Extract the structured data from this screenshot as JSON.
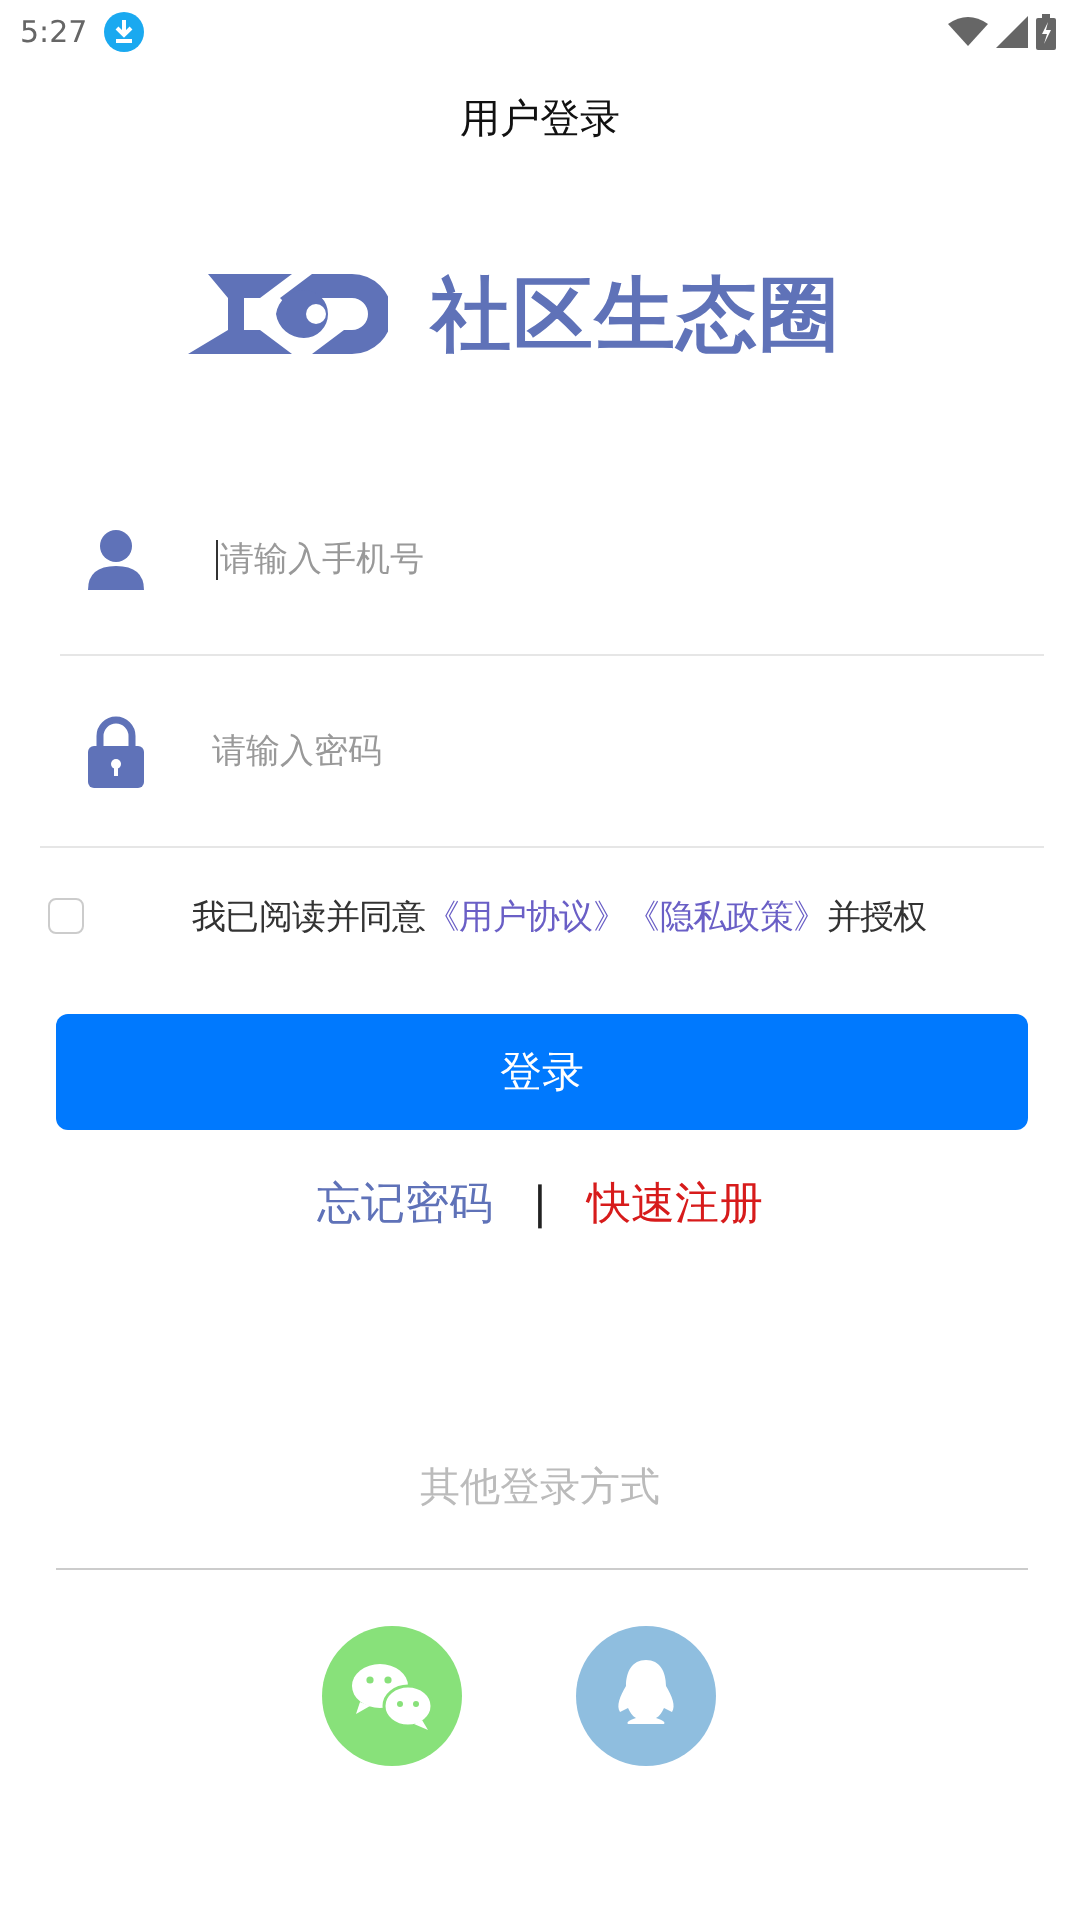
{
  "status_bar": {
    "time": "5:27"
  },
  "title": "用户登录",
  "logo": {
    "name": "社区生态圈"
  },
  "fields": [
    {
      "kind": "phone",
      "placeholder": "请输入手机号",
      "focused": true
    },
    {
      "kind": "password",
      "placeholder": "请输入密码",
      "focused": false
    }
  ],
  "agreement": {
    "checked": false,
    "text_before": "我已阅读并同意",
    "links": [
      "《用户协议》",
      "《隐私政策》"
    ],
    "text_after": "并授权"
  },
  "login_button": "登录",
  "links": [
    {
      "label": "忘记密码",
      "kind": "forgot"
    },
    {
      "label": "|",
      "kind": "separator"
    },
    {
      "label": "快速注册",
      "kind": "register"
    }
  ],
  "other_login": {
    "label": "其他登录方式",
    "options": [
      {
        "kind": "wechat",
        "color": "#88e17a"
      },
      {
        "kind": "qq",
        "color": "#8fbedf"
      }
    ]
  }
}
